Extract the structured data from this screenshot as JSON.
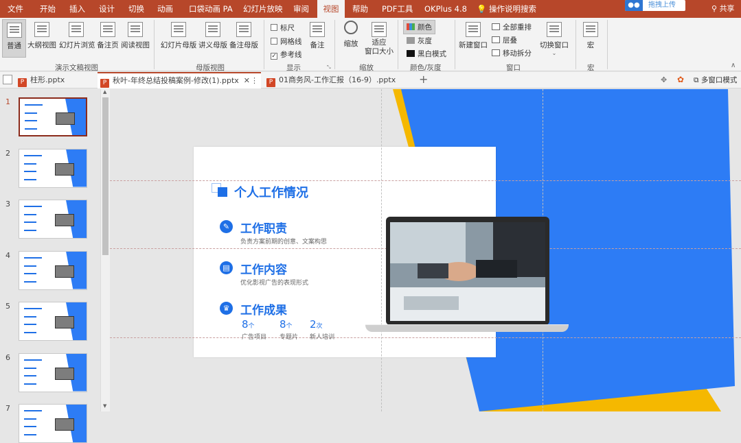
{
  "menu": {
    "items": [
      "文件",
      "开始",
      "插入",
      "设计",
      "切换",
      "动画",
      "口袋动画 PA",
      "幻灯片放映",
      "审阅",
      "视图",
      "帮助",
      "PDF工具",
      "OKPlus 4.8"
    ],
    "search": "操作说明搜索",
    "upload": "拖拽上传",
    "share": "共享"
  },
  "ribbon": {
    "views": [
      "普通",
      "大纲视图",
      "幻灯片浏览",
      "备注页",
      "阅读视图"
    ],
    "views_group": "演示文稿视图",
    "masters": [
      "幻灯片母版",
      "讲义母版",
      "备注母版"
    ],
    "masters_group": "母版视图",
    "show": {
      "ruler": "标尺",
      "gridlines": "网格线",
      "guides": "参考线",
      "notes": "备注",
      "group": "显示"
    },
    "zoom": {
      "zoom": "缩放",
      "fit": "适应窗口大小",
      "fit_line1": "适应",
      "fit_line2": "窗口大小",
      "group": "缩放"
    },
    "color": {
      "color": "颜色",
      "gray": "灰度",
      "bw": "黑白模式",
      "group": "颜色/灰度"
    },
    "window": {
      "new": "新建窗口",
      "arrange": "全部重排",
      "cascade": "层叠",
      "move_split": "移动拆分",
      "switch": "切换窗口",
      "group": "窗口"
    },
    "macro": {
      "label": "宏",
      "group": "宏"
    }
  },
  "tabs": [
    {
      "label": "柱形.pptx"
    },
    {
      "label": "秋叶-年终总结投稿案例-修改(1).pptx"
    },
    {
      "label": "01商务风-工作汇报（16-9）.pptx"
    }
  ],
  "tab_right": {
    "multi_window": "多窗口模式"
  },
  "thumbnails": {
    "numbers": [
      "1",
      "2",
      "3",
      "4",
      "5",
      "6",
      "7"
    ]
  },
  "slide": {
    "title": "个人工作情况",
    "sections": [
      {
        "title": "工作职责",
        "desc": "负责方案前期的创意、文案构思"
      },
      {
        "title": "工作内容",
        "desc": "优化影视广告的表现形式"
      },
      {
        "title": "工作成果",
        "desc": ""
      }
    ],
    "stats": [
      {
        "num": "8",
        "unit": "个",
        "label": "广告项目"
      },
      {
        "num": "8",
        "unit": "个",
        "label": "专题片"
      },
      {
        "num": "2",
        "unit": "次",
        "label": "新人培训"
      }
    ]
  },
  "colors": {
    "accent": "#b7472a",
    "slide_blue": "#1e6fe6",
    "slide_band": "#2d7cf5",
    "slide_yellow": "#f5b800"
  }
}
